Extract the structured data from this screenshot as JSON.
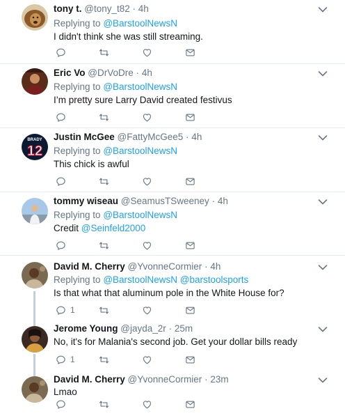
{
  "tweets": [
    {
      "name": "tony t.",
      "handle": "@tony_t82",
      "time": "4h",
      "replying_prefix": "Replying to",
      "replying_to": "@BarstoolNewsN",
      "text": "I didn't think she was still streaming.",
      "reply_count": ""
    },
    {
      "name": "Eric Vo",
      "handle": "@DrVoDre",
      "time": "4h",
      "replying_prefix": "Replying to",
      "replying_to": "@BarstoolNewsN",
      "text": "I’m pretty sure Larry David created festivus",
      "reply_count": ""
    },
    {
      "name": "Justin McGee",
      "handle": "@FattyMcGee5",
      "time": "4h",
      "replying_prefix": "Replying to",
      "replying_to": "@BarstoolNewsN",
      "text": "This chick is awful",
      "reply_count": "",
      "avatar_label": "BRADY",
      "avatar_number": "12"
    },
    {
      "name": "tommy wiseau",
      "handle": "@SeamusTSweeney",
      "time": "4h",
      "replying_prefix": "Replying to",
      "replying_to": "@BarstoolNewsN",
      "text_prefix": "Credit",
      "text_mention": "@Seinfeld2000",
      "reply_count": ""
    },
    {
      "name": "David M. Cherry",
      "handle": "@YvonneCormier",
      "time": "4h",
      "replying_prefix": "Replying to",
      "replying_to": "@BarstoolNewsN @barstoolsports",
      "text": "Is that what that aluminum pole in the White House for?",
      "reply_count": "1"
    },
    {
      "name": "Jerome Young",
      "handle": "@jayda_2r",
      "time": "25m",
      "text": "No, it's for Malania's second job. Get your dollar bills ready",
      "reply_count": "1"
    },
    {
      "name": "David M. Cherry",
      "handle": "@YvonneCormier",
      "time": "23m",
      "text": "Lmao",
      "reply_count": ""
    }
  ],
  "dot": "·",
  "colors": {
    "link": "#1da1f2",
    "secondary": "#657786",
    "separator": "#e6ecf0",
    "thread_line": "#c4cfd6"
  },
  "icons": [
    "reply-icon",
    "retweet-icon",
    "like-icon",
    "direct-message-icon",
    "chevron-down-icon"
  ]
}
